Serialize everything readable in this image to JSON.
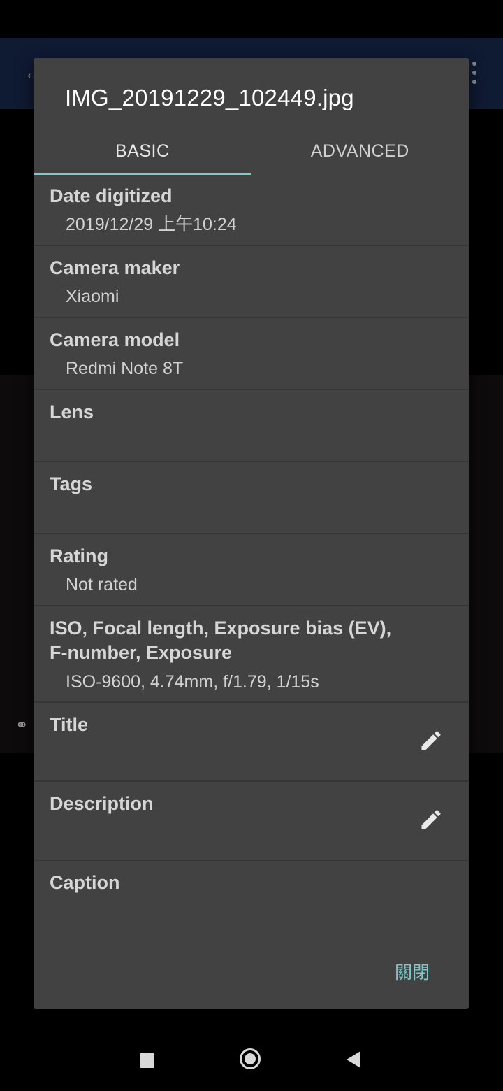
{
  "dialog": {
    "title": "IMG_20191229_102449.jpg",
    "tabs": [
      {
        "label": "BASIC",
        "active": true
      },
      {
        "label": "ADVANCED",
        "active": false
      }
    ],
    "rows": [
      {
        "label": "Date digitized",
        "value": "2019/12/29 上午10:24"
      },
      {
        "label": "Camera maker",
        "value": "Xiaomi"
      },
      {
        "label": "Camera model",
        "value": "Redmi Note 8T"
      },
      {
        "label": "Lens",
        "value": ""
      },
      {
        "label": "Tags",
        "value": ""
      },
      {
        "label": "Rating",
        "value": "Not rated"
      },
      {
        "label": "ISO, Focal length, Exposure bias (EV), F-number, Exposure",
        "value": "ISO-9600, 4.74mm, f/1.79, 1/15s"
      },
      {
        "label": "Title",
        "value": "",
        "editable": true
      },
      {
        "label": "Description",
        "value": "",
        "editable": true
      },
      {
        "label": "Caption",
        "value": ""
      }
    ],
    "close_label": "關閉"
  },
  "colors": {
    "dialog_bg": "#424242",
    "accent": "#7ec8c9"
  }
}
